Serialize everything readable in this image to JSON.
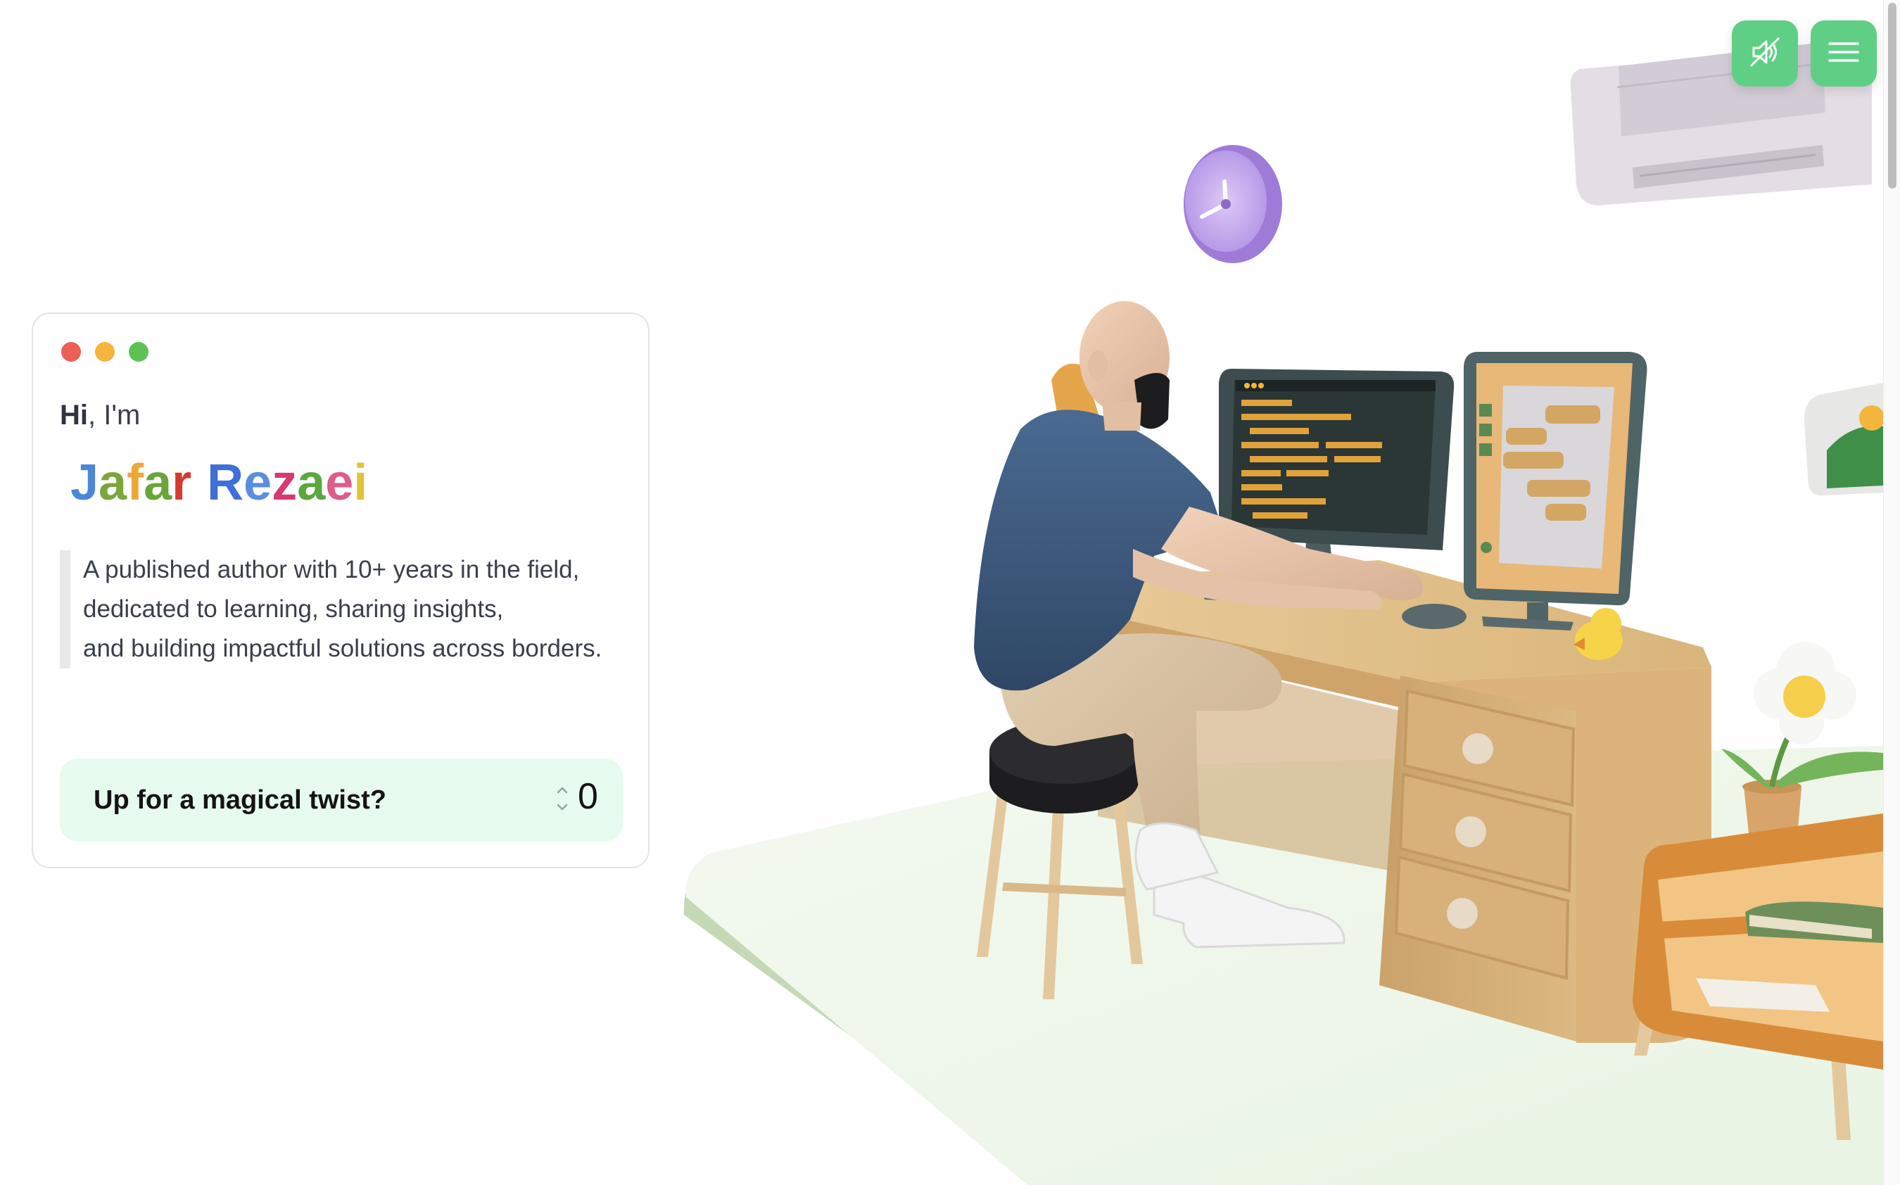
{
  "header": {
    "mute_icon": "sound-off-icon",
    "menu_icon": "hamburger-menu-icon",
    "accent_color": "#5fcf86"
  },
  "intro": {
    "greeting_bold": "Hi",
    "greeting_rest": ", I'm",
    "name_first": "Jafar",
    "name_last": "Rezaei",
    "bio_lines": [
      "A published author with 10+ years in the field,",
      "dedicated to learning, sharing insights,",
      "and building impactful solutions across borders."
    ],
    "twist_label": "Up for a magical twist?",
    "twist_count": "0",
    "window_dot_colors": [
      "#ec5f57",
      "#f3b53d",
      "#5cc352"
    ]
  }
}
